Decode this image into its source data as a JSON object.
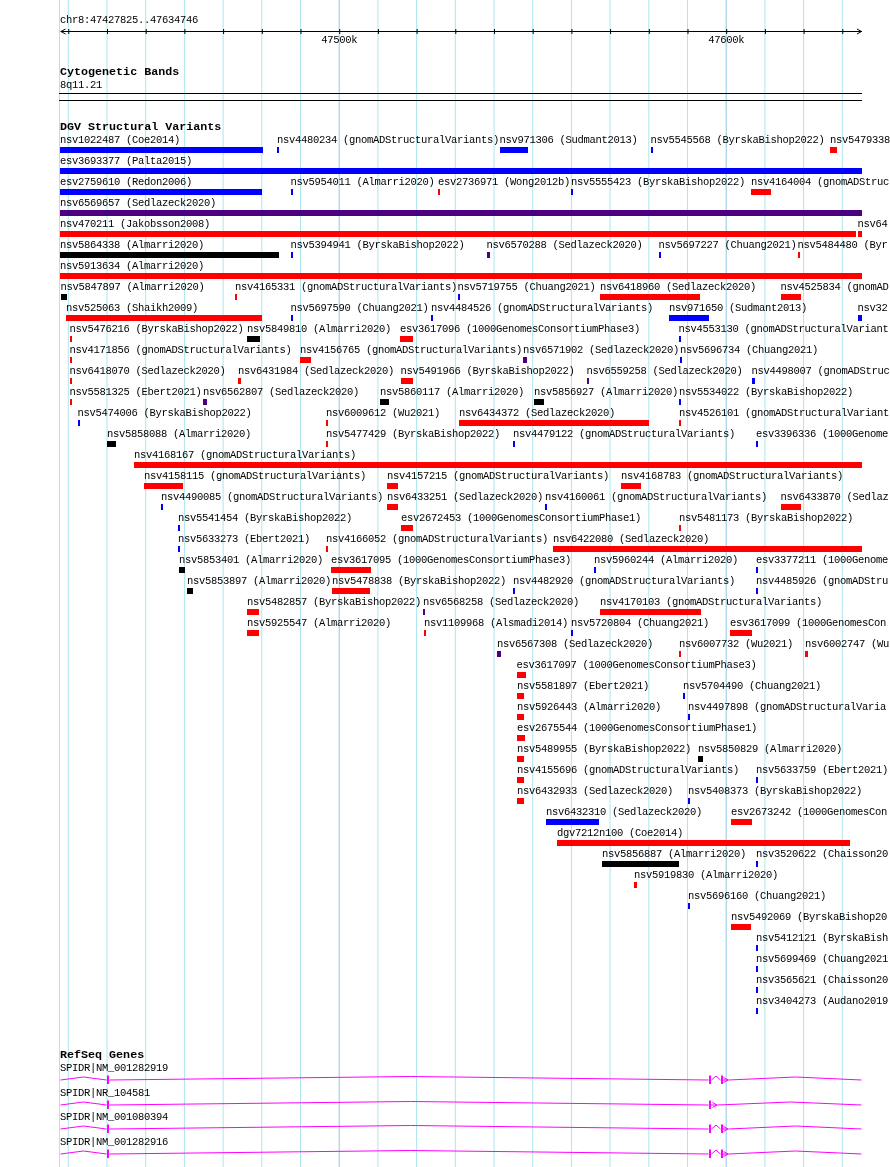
{
  "ruler": {
    "region": "chr8:47427825..47634746",
    "tick_labels": [
      "47500k",
      "47600k"
    ]
  },
  "cytogenetic_bands": {
    "title": "Cytogenetic Bands",
    "band": "8q11.21"
  },
  "structural_variants": {
    "title": "DGV Structural Variants",
    "rows": [
      {
        "features": [
          {
            "label": "nsv1022487 (Coe2014)",
            "color": "#0000ff"
          },
          {
            "label": "nsv4480234 (gnomADStructuralVariants)",
            "color": "#0000ff"
          },
          {
            "label": "nsv971306 (Sudmant2013)",
            "color": "#0000ff"
          },
          {
            "label": "nsv5545568 (ByrskaBishop2022)",
            "color": "#0000ff"
          },
          {
            "label": "nsv5479338",
            "color": "#ff0000"
          }
        ]
      },
      {
        "features": [
          {
            "label": "esv3693377 (Palta2015)",
            "color": "#0000ff"
          }
        ]
      },
      {
        "features": [
          {
            "label": "esv2759610 (Redon2006)",
            "color": "#0000ff"
          },
          {
            "label": "nsv5954011 (Almarri2020)",
            "color": "#0000ff"
          },
          {
            "label": "esv2736971 (Wong2012b)",
            "color": "#ff0000"
          },
          {
            "label": "nsv5555423 (ByrskaBishop2022)",
            "color": "#0000ff"
          },
          {
            "label": "nsv4164004 (gnomADStruc",
            "color": "#ff0000"
          }
        ]
      },
      {
        "features": [
          {
            "label": "nsv6569657 (Sedlazeck2020)",
            "color": "#4b0082"
          }
        ]
      },
      {
        "features": [
          {
            "label": "nsv470211 (Jakobsson2008)",
            "color": "#ff0000"
          },
          {
            "label": "nsv64",
            "color": "#ff0000"
          }
        ]
      },
      {
        "features": [
          {
            "label": "nsv5864338 (Almarri2020)",
            "color": "#000000"
          },
          {
            "label": "nsv5394941 (ByrskaBishop2022)",
            "color": "#0000ff"
          },
          {
            "label": "nsv6570288 (Sedlazeck2020)",
            "color": "#4b0082"
          },
          {
            "label": "nsv5697227 (Chuang2021)",
            "color": "#0000ff"
          },
          {
            "label": "nsv5484480 (Byr",
            "color": "#ff0000"
          }
        ]
      },
      {
        "features": [
          {
            "label": "nsv5913634 (Almarri2020)",
            "color": "#ff0000"
          }
        ]
      },
      {
        "features": [
          {
            "label": "nsv5847897 (Almarri2020)",
            "color": "#000000"
          },
          {
            "label": "nsv4165331 (gnomADStructuralVariants)",
            "color": "#ff0000"
          },
          {
            "label": "nsv5719755 (Chuang2021)",
            "color": "#0000ff"
          },
          {
            "label": "nsv6418960 (Sedlazeck2020)",
            "color": "#ff0000"
          },
          {
            "label": "nsv4525834 (gnomAD",
            "color": "#ff0000"
          }
        ]
      },
      {
        "features": [
          {
            "label": "nsv525063 (Shaikh2009)",
            "color": "#ff0000"
          },
          {
            "label": "nsv5697590 (Chuang2021)",
            "color": "#0000ff"
          },
          {
            "label": "nsv4484526 (gnomADStructuralVariants)",
            "color": "#0000ff"
          },
          {
            "label": "nsv971650 (Sudmant2013)",
            "color": "#0000ff"
          },
          {
            "label": "nsv32",
            "color": "#0000ff"
          }
        ]
      },
      {
        "features": [
          {
            "label": "nsv5476216 (ByrskaBishop2022)",
            "color": "#ff0000"
          },
          {
            "label": "nsv5849810 (Almarri2020)",
            "color": "#000000"
          },
          {
            "label": "esv3617096 (1000GenomesConsortiumPhase3)",
            "color": "#ff0000"
          },
          {
            "label": "nsv4553130 (gnomADStructuralVariant",
            "color": "#0000ff"
          }
        ]
      },
      {
        "features": [
          {
            "label": "nsv4171856 (gnomADStructuralVariants)",
            "color": "#ff0000"
          },
          {
            "label": "nsv4156765 (gnomADStructuralVariants)",
            "color": "#ff0000"
          },
          {
            "label": "nsv6571902 (Sedlazeck2020)",
            "color": "#4b0082"
          },
          {
            "label": "nsv5696734 (Chuang2021)",
            "color": "#0000ff"
          }
        ]
      },
      {
        "features": [
          {
            "label": "nsv6418070 (Sedlazeck2020)",
            "color": "#ff0000"
          },
          {
            "label": "nsv6431984 (Sedlazeck2020)",
            "color": "#ff0000"
          },
          {
            "label": "nsv5491966 (ByrskaBishop2022)",
            "color": "#ff0000"
          },
          {
            "label": "nsv6559258 (Sedlazeck2020)",
            "color": "#4b0082"
          },
          {
            "label": "nsv4498007 (gnomADStruc",
            "color": "#0000ff"
          }
        ]
      },
      {
        "features": [
          {
            "label": "nsv5581325 (Ebert2021)",
            "color": "#ff0000"
          },
          {
            "label": "nsv6562807 (Sedlazeck2020)",
            "color": "#4b0082"
          },
          {
            "label": "nsv5860117 (Almarri2020)",
            "color": "#000000"
          },
          {
            "label": "nsv5856927 (Almarri2020)",
            "color": "#000000"
          },
          {
            "label": "nsv5534022 (ByrskaBishop2022)",
            "color": "#0000ff"
          }
        ]
      },
      {
        "features": [
          {
            "label": "nsv5474006 (ByrskaBishop2022)",
            "color": "#0000ff"
          },
          {
            "label": "nsv6009612 (Wu2021)",
            "color": "#ff0000"
          },
          {
            "label": "nsv6434372 (Sedlazeck2020)",
            "color": "#ff0000"
          },
          {
            "label": "nsv4526101 (gnomADStructuralVariant",
            "color": "#ff0000"
          }
        ]
      },
      {
        "features": [
          {
            "label": "nsv5858088 (Almarri2020)",
            "color": "#000000"
          },
          {
            "label": "nsv5477429 (ByrskaBishop2022)",
            "color": "#ff0000"
          },
          {
            "label": "nsv4479122 (gnomADStructuralVariants)",
            "color": "#0000ff"
          },
          {
            "label": "esv3396336 (1000Genome",
            "color": "#0000ff"
          }
        ]
      },
      {
        "features": [
          {
            "label": "nsv4168167 (gnomADStructuralVariants)",
            "color": "#ff0000"
          }
        ]
      },
      {
        "features": [
          {
            "label": "nsv4158115 (gnomADStructuralVariants)",
            "color": "#ff0000"
          },
          {
            "label": "nsv4157215 (gnomADStructuralVariants)",
            "color": "#ff0000"
          },
          {
            "label": "nsv4168783 (gnomADStructuralVariants)",
            "color": "#ff0000"
          }
        ]
      },
      {
        "features": [
          {
            "label": "nsv4490085 (gnomADStructuralVariants)",
            "color": "#0000ff"
          },
          {
            "label": "nsv6433251 (Sedlazeck2020)",
            "color": "#ff0000"
          },
          {
            "label": "nsv4160061 (gnomADStructuralVariants)",
            "color": "#0000ff"
          },
          {
            "label": "nsv6433870 (Sedlaz",
            "color": "#ff0000"
          }
        ]
      },
      {
        "features": [
          {
            "label": "nsv5541454 (ByrskaBishop2022)",
            "color": "#0000ff"
          },
          {
            "label": "esv2672453 (1000GenomesConsortiumPhase1)",
            "color": "#ff0000"
          },
          {
            "label": "nsv5481173 (ByrskaBishop2022)",
            "color": "#ff0000"
          }
        ]
      },
      {
        "features": [
          {
            "label": "nsv5633273 (Ebert2021)",
            "color": "#0000ff"
          },
          {
            "label": "nsv4166052 (gnomADStructuralVariants)",
            "color": "#ff0000"
          },
          {
            "label": "nsv6422080 (Sedlazeck2020)",
            "color": "#ff0000"
          }
        ]
      },
      {
        "features": [
          {
            "label": "nsv5853401 (Almarri2020)",
            "color": "#000000"
          },
          {
            "label": "esv3617095 (1000GenomesConsortiumPhase3)",
            "color": "#ff0000"
          },
          {
            "label": "nsv5960244 (Almarri2020)",
            "color": "#0000ff"
          },
          {
            "label": "esv3377211 (1000Genome",
            "color": "#0000ff"
          }
        ]
      },
      {
        "features": [
          {
            "label": "nsv5853897 (Almarri2020)",
            "color": "#000000"
          },
          {
            "label": "nsv5478838 (ByrskaBishop2022)",
            "color": "#ff0000"
          },
          {
            "label": "nsv4482920 (gnomADStructuralVariants)",
            "color": "#0000ff"
          },
          {
            "label": "nsv4485926 (gnomADStru",
            "color": "#0000ff"
          }
        ]
      },
      {
        "features": [
          {
            "label": "nsv5482857 (ByrskaBishop2022)",
            "color": "#ff0000"
          },
          {
            "label": "nsv6568258 (Sedlazeck2020)",
            "color": "#4b0082"
          },
          {
            "label": "nsv4170103 (gnomADStructuralVariants)",
            "color": "#ff0000"
          }
        ]
      },
      {
        "features": [
          {
            "label": "nsv5925547 (Almarri2020)",
            "color": "#ff0000"
          },
          {
            "label": "nsv1109968 (Alsmadi2014)",
            "color": "#ff0000"
          },
          {
            "label": "nsv5720804 (Chuang2021)",
            "color": "#0000ff"
          },
          {
            "label": "esv3617099 (1000GenomesCon",
            "color": "#ff0000"
          }
        ]
      },
      {
        "features": [
          {
            "label": "nsv6567308 (Sedlazeck2020)",
            "color": "#4b0082"
          },
          {
            "label": "nsv6007732 (Wu2021)",
            "color": "#ff0000"
          },
          {
            "label": "nsv6002747 (Wu",
            "color": "#ff0000"
          }
        ]
      },
      {
        "features": [
          {
            "label": "esv3617097 (1000GenomesConsortiumPhase3)",
            "color": "#ff0000"
          }
        ]
      },
      {
        "features": [
          {
            "label": "nsv5581897 (Ebert2021)",
            "color": "#ff0000"
          },
          {
            "label": "nsv5704490 (Chuang2021)",
            "color": "#0000ff"
          }
        ]
      },
      {
        "features": [
          {
            "label": "nsv5926443 (Almarri2020)",
            "color": "#ff0000"
          },
          {
            "label": "nsv4497898 (gnomADStructuralVaria",
            "color": "#0000ff"
          }
        ]
      },
      {
        "features": [
          {
            "label": "esv2675544 (1000GenomesConsortiumPhase1)",
            "color": "#ff0000"
          }
        ]
      },
      {
        "features": [
          {
            "label": "nsv5489955 (ByrskaBishop2022)",
            "color": "#ff0000"
          },
          {
            "label": "nsv5850829 (Almarri2020)",
            "color": "#000000"
          }
        ]
      },
      {
        "features": [
          {
            "label": "nsv4155696 (gnomADStructuralVariants)",
            "color": "#ff0000"
          },
          {
            "label": "nsv5633759 (Ebert2021)",
            "color": "#0000ff"
          }
        ]
      },
      {
        "features": [
          {
            "label": "nsv6432933 (Sedlazeck2020)",
            "color": "#ff0000"
          },
          {
            "label": "nsv5408373 (ByrskaBishop2022)",
            "color": "#0000ff"
          }
        ]
      },
      {
        "features": [
          {
            "label": "nsv6432310 (Sedlazeck2020)",
            "color": "#0000ff"
          },
          {
            "label": "esv2673242 (1000GenomesCon",
            "color": "#ff0000"
          }
        ]
      },
      {
        "features": [
          {
            "label": "dgv7212n100 (Coe2014)",
            "color": "#ff0000"
          }
        ]
      },
      {
        "features": [
          {
            "label": "nsv5856887 (Almarri2020)",
            "color": "#000000"
          },
          {
            "label": "nsv3520622 (Chaisson20",
            "color": "#0000ff"
          }
        ]
      },
      {
        "features": [
          {
            "label": "nsv5919830 (Almarri2020)",
            "color": "#ff0000"
          }
        ]
      },
      {
        "features": [
          {
            "label": "nsv5696160 (Chuang2021)",
            "color": "#0000ff"
          }
        ]
      },
      {
        "features": [
          {
            "label": "nsv5492069 (ByrskaBishop20",
            "color": "#ff0000"
          }
        ]
      },
      {
        "features": [
          {
            "label": "nsv5412121 (ByrskaBish",
            "color": "#0000ff"
          }
        ]
      },
      {
        "features": [
          {
            "label": "nsv5699469 (Chuang2021",
            "color": "#0000ff"
          }
        ]
      },
      {
        "features": [
          {
            "label": "nsv3565621 (Chaisson20",
            "color": "#0000ff"
          }
        ]
      },
      {
        "features": [
          {
            "label": "nsv3404273 (Audano2019",
            "color": "#0000ff"
          }
        ]
      }
    ]
  },
  "refseq_genes": {
    "title": "RefSeq Genes",
    "genes": [
      {
        "label": "SPIDR|NM_001282919"
      },
      {
        "label": "SPIDR|NR_104581"
      },
      {
        "label": "SPIDR|NM_001080394"
      },
      {
        "label": "SPIDR|NM_001282916"
      }
    ]
  }
}
